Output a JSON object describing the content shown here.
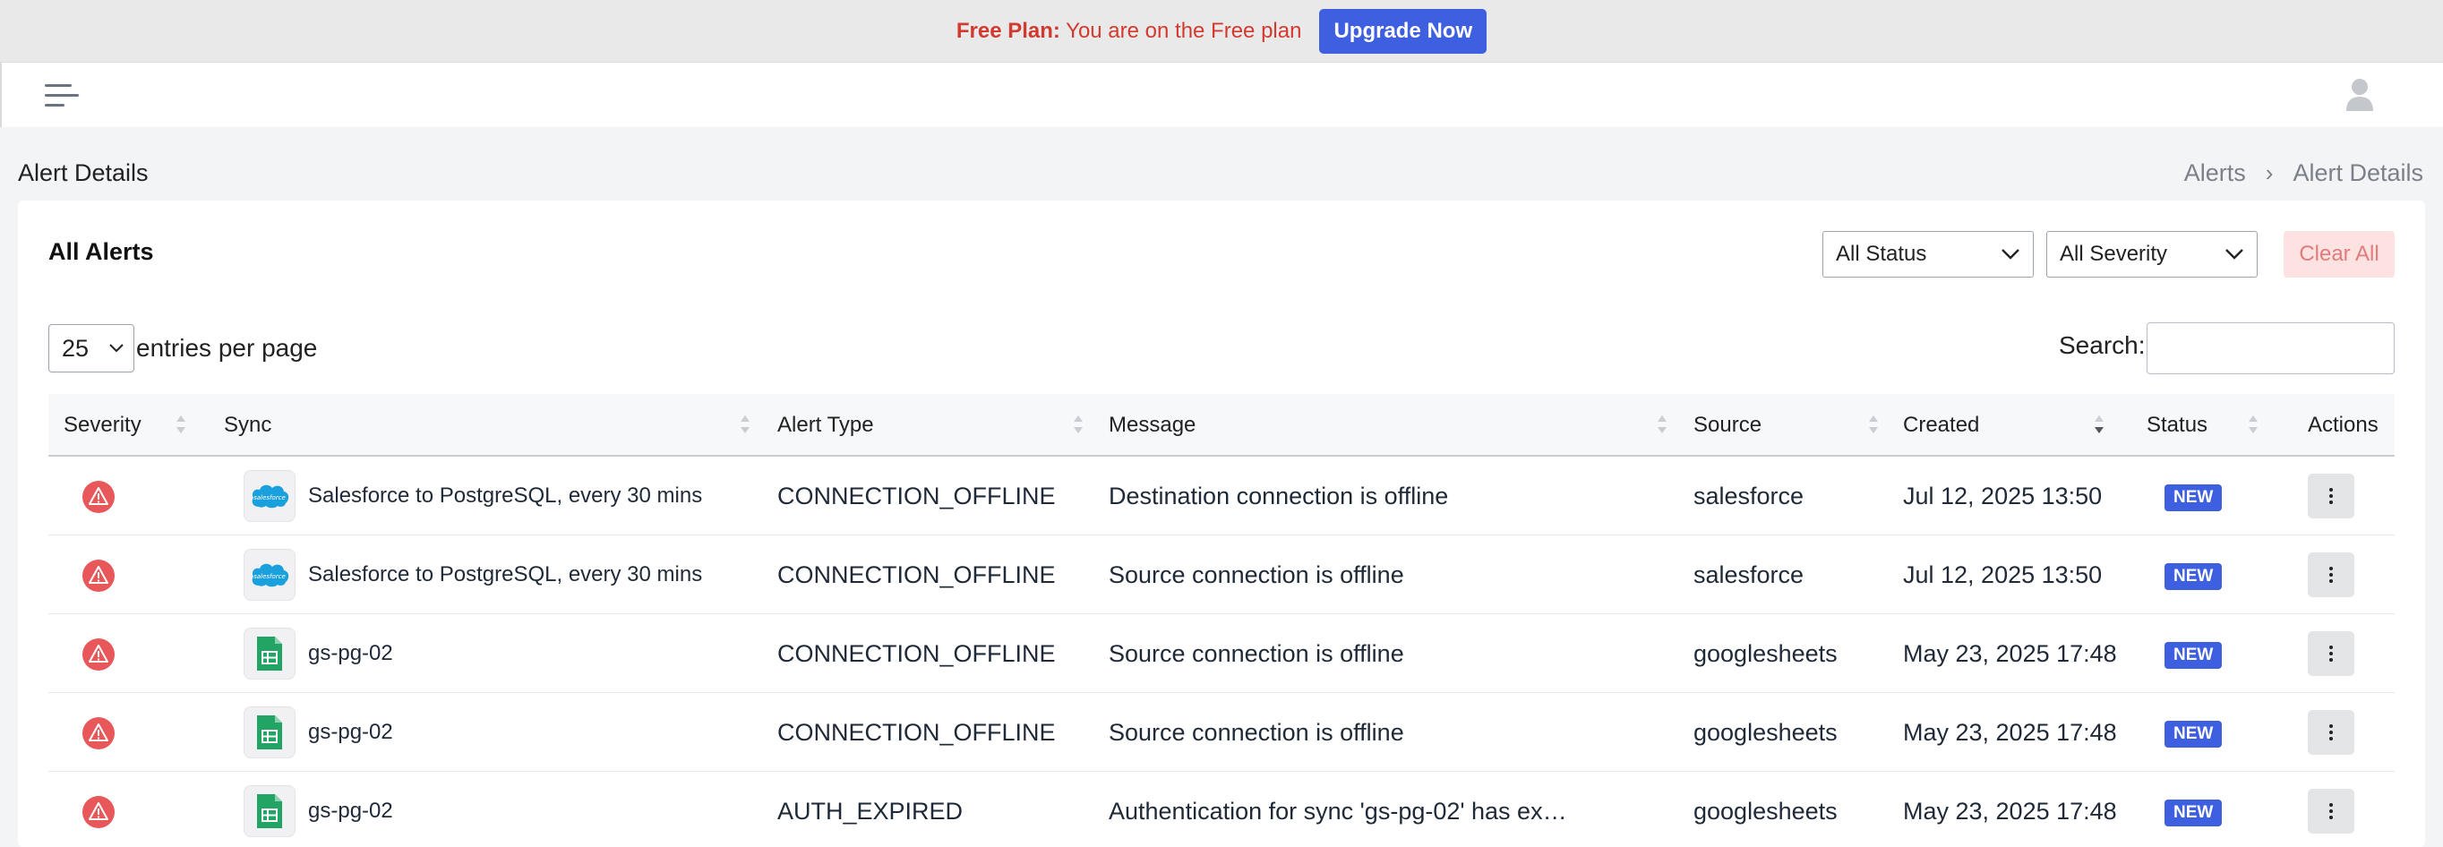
{
  "banner": {
    "plan_label": "Free Plan:",
    "plan_text": "You are on the Free plan",
    "upgrade_label": "Upgrade Now"
  },
  "header": {
    "menu_icon": "hamburger-menu-icon",
    "user_icon": "user-avatar-icon"
  },
  "page": {
    "title": "Alert Details",
    "breadcrumb": [
      {
        "label": "Alerts"
      },
      {
        "label": "Alert Details"
      }
    ]
  },
  "card": {
    "title": "All Alerts",
    "status_filter": "All Status",
    "severity_filter": "All Severity",
    "clear_label": "Clear All",
    "entries_value": "25",
    "entries_label": "entries per page",
    "search_label": "Search:",
    "search_value": ""
  },
  "table": {
    "columns": [
      "Severity",
      "Sync",
      "Alert Type",
      "Message",
      "Source",
      "Created",
      "Status",
      "Actions"
    ],
    "rows": [
      {
        "severity_icon": "alert-triangle-icon",
        "source_icon": "salesforce-cloud-icon",
        "sync": "Salesforce to PostgreSQL, every 30 mins",
        "alert_type": "CONNECTION_OFFLINE",
        "message": "Destination connection is offline",
        "source": "salesforce",
        "created": "Jul 12, 2025 13:50",
        "status": "NEW"
      },
      {
        "severity_icon": "alert-triangle-icon",
        "source_icon": "salesforce-cloud-icon",
        "sync": "Salesforce to PostgreSQL, every 30 mins",
        "alert_type": "CONNECTION_OFFLINE",
        "message": "Source connection is offline",
        "source": "salesforce",
        "created": "Jul 12, 2025 13:50",
        "status": "NEW"
      },
      {
        "severity_icon": "alert-triangle-icon",
        "source_icon": "google-sheets-icon",
        "sync": "gs-pg-02",
        "alert_type": "CONNECTION_OFFLINE",
        "message": "Source connection is offline",
        "source": "googlesheets",
        "created": "May 23, 2025 17:48",
        "status": "NEW"
      },
      {
        "severity_icon": "alert-triangle-icon",
        "source_icon": "google-sheets-icon",
        "sync": "gs-pg-02",
        "alert_type": "CONNECTION_OFFLINE",
        "message": "Source connection is offline",
        "source": "googlesheets",
        "created": "May 23, 2025 17:48",
        "status": "NEW"
      },
      {
        "severity_icon": "alert-triangle-icon",
        "source_icon": "google-sheets-icon",
        "sync": "gs-pg-02",
        "alert_type": "AUTH_EXPIRED",
        "message": "Authentication for sync 'gs-pg-02' has ex…",
        "source": "googlesheets",
        "created": "May 23, 2025 17:48",
        "status": "NEW"
      }
    ]
  },
  "colors": {
    "accent": "#3d5fe0",
    "danger": "#e8575a",
    "banner_text": "#d33a2f",
    "clear_bg": "#fde2e2"
  }
}
